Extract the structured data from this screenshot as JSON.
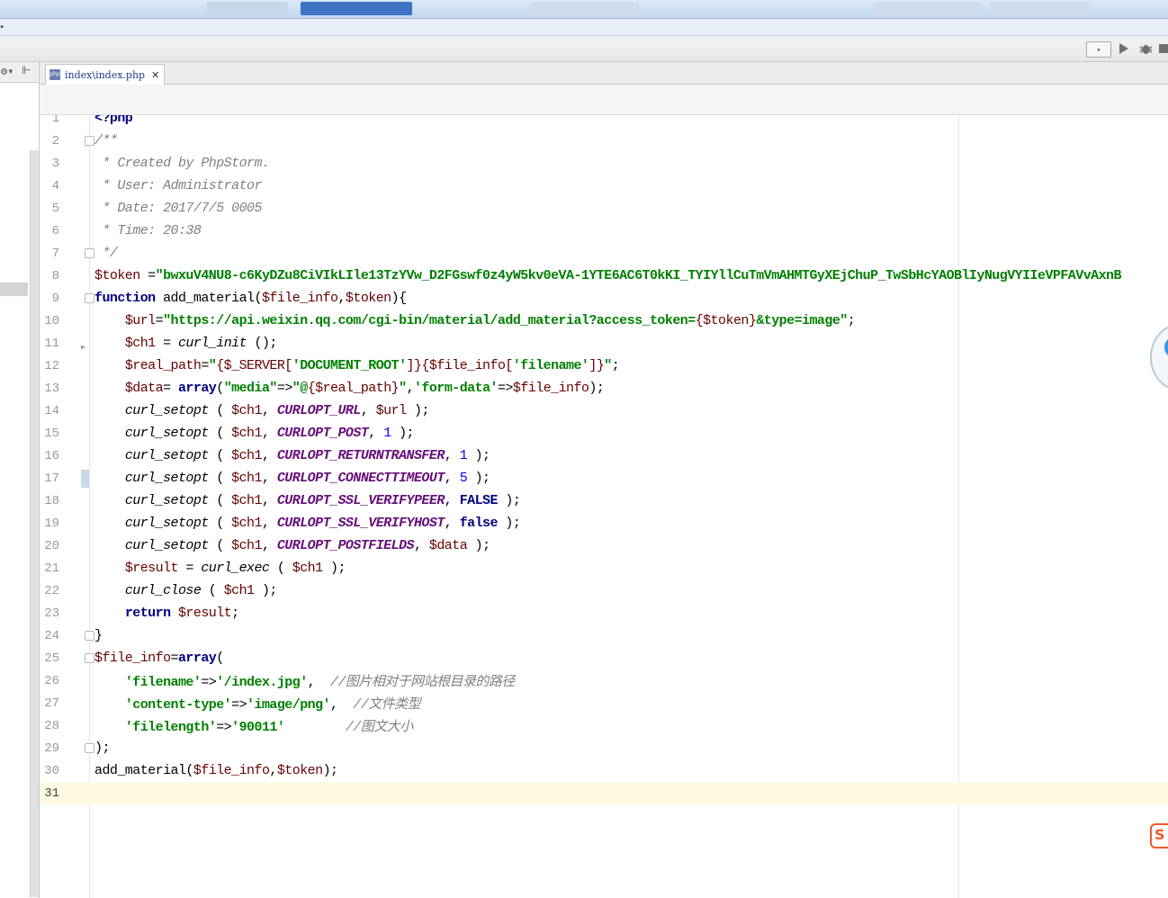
{
  "tab": {
    "label": "index\\index.php",
    "file_type": "php",
    "close": "✕"
  },
  "menu": {
    "caret": "▸"
  },
  "toolbar": {
    "run_config": "▾",
    "run": "▶",
    "debug": "✹"
  },
  "left_panel": {
    "gear": "⚙▾",
    "pin": "⊩"
  },
  "badge": {
    "logo_text": "S"
  },
  "editor": {
    "current_line": 31,
    "lines": [
      [
        {
          "t": "<?php",
          "c": "phptag"
        }
      ],
      [
        {
          "t": "/**",
          "c": "cmt"
        }
      ],
      [
        {
          "t": " * Created by PhpStorm.",
          "c": "cmt"
        }
      ],
      [
        {
          "t": " * User: Administrator",
          "c": "cmt"
        }
      ],
      [
        {
          "t": " * Date: 2017/7/5 0005",
          "c": "cmt"
        }
      ],
      [
        {
          "t": " * Time: 20:38",
          "c": "cmt"
        }
      ],
      [
        {
          "t": " */",
          "c": "cmt"
        }
      ],
      [
        {
          "t": "$token",
          "c": "var"
        },
        {
          "t": " =",
          "c": ""
        },
        {
          "t": "\"bwxuV4NU8-c6KyDZu8CiVIkLIle13TzYVw_D2FGswf0z4yW5kv0eVA-1YTE6AC6T0kKI_TYIYllCuTmVmAHMTGyXEjChuP_TwSbHcYAOBlIyNugVYIIeVPFAVvAxnB",
          "c": "str"
        }
      ],
      [
        {
          "t": "function",
          "c": "kw"
        },
        {
          "t": " add_material(",
          "c": ""
        },
        {
          "t": "$file_info",
          "c": "var"
        },
        {
          "t": ",",
          "c": ""
        },
        {
          "t": "$token",
          "c": "var"
        },
        {
          "t": "){",
          "c": ""
        }
      ],
      [
        {
          "t": "    ",
          "c": ""
        },
        {
          "t": "$url",
          "c": "var"
        },
        {
          "t": "=",
          "c": ""
        },
        {
          "t": "\"https://api.weixin.qq.com/cgi-bin/material/add_material?access_token=",
          "c": "str"
        },
        {
          "t": "{$token}",
          "c": "var"
        },
        {
          "t": "&type=image\"",
          "c": "str"
        },
        {
          "t": ";",
          "c": ""
        }
      ],
      [
        {
          "t": "    ",
          "c": ""
        },
        {
          "t": "$ch1",
          "c": "var"
        },
        {
          "t": " = ",
          "c": ""
        },
        {
          "t": "curl_init",
          "c": "fn"
        },
        {
          "t": " ();",
          "c": ""
        }
      ],
      [
        {
          "t": "    ",
          "c": ""
        },
        {
          "t": "$real_path",
          "c": "var"
        },
        {
          "t": "=",
          "c": ""
        },
        {
          "t": "\"",
          "c": "str"
        },
        {
          "t": "{$_SERVER[",
          "c": "var"
        },
        {
          "t": "'DOCUMENT_ROOT'",
          "c": "str"
        },
        {
          "t": "]}{$file_info[",
          "c": "var"
        },
        {
          "t": "'filename'",
          "c": "str"
        },
        {
          "t": "]}",
          "c": "var"
        },
        {
          "t": "\"",
          "c": "str"
        },
        {
          "t": ";",
          "c": ""
        }
      ],
      [
        {
          "t": "    ",
          "c": ""
        },
        {
          "t": "$data",
          "c": "var"
        },
        {
          "t": "= ",
          "c": ""
        },
        {
          "t": "array",
          "c": "kw"
        },
        {
          "t": "(",
          "c": ""
        },
        {
          "t": "\"media\"",
          "c": "str"
        },
        {
          "t": "=>",
          "c": ""
        },
        {
          "t": "\"@",
          "c": "str"
        },
        {
          "t": "{$real_path}",
          "c": "var"
        },
        {
          "t": "\"",
          "c": "str"
        },
        {
          "t": ",",
          "c": ""
        },
        {
          "t": "'form-data'",
          "c": "str"
        },
        {
          "t": "=>",
          "c": ""
        },
        {
          "t": "$file_info",
          "c": "var"
        },
        {
          "t": ");",
          "c": ""
        }
      ],
      [
        {
          "t": "    ",
          "c": ""
        },
        {
          "t": "curl_setopt",
          "c": "fn"
        },
        {
          "t": " ( ",
          "c": ""
        },
        {
          "t": "$ch1",
          "c": "var"
        },
        {
          "t": ", ",
          "c": ""
        },
        {
          "t": "CURLOPT_URL",
          "c": "const"
        },
        {
          "t": ", ",
          "c": ""
        },
        {
          "t": "$url",
          "c": "var"
        },
        {
          "t": " );",
          "c": ""
        }
      ],
      [
        {
          "t": "    ",
          "c": ""
        },
        {
          "t": "curl_setopt",
          "c": "fn"
        },
        {
          "t": " ( ",
          "c": ""
        },
        {
          "t": "$ch1",
          "c": "var"
        },
        {
          "t": ", ",
          "c": ""
        },
        {
          "t": "CURLOPT_POST",
          "c": "const"
        },
        {
          "t": ", ",
          "c": ""
        },
        {
          "t": "1",
          "c": "num"
        },
        {
          "t": " );",
          "c": ""
        }
      ],
      [
        {
          "t": "    ",
          "c": ""
        },
        {
          "t": "curl_setopt",
          "c": "fn"
        },
        {
          "t": " ( ",
          "c": ""
        },
        {
          "t": "$ch1",
          "c": "var"
        },
        {
          "t": ", ",
          "c": ""
        },
        {
          "t": "CURLOPT_RETURNTRANSFER",
          "c": "const"
        },
        {
          "t": ", ",
          "c": ""
        },
        {
          "t": "1",
          "c": "num"
        },
        {
          "t": " );",
          "c": ""
        }
      ],
      [
        {
          "t": "    ",
          "c": ""
        },
        {
          "t": "curl_setopt",
          "c": "fn"
        },
        {
          "t": " ( ",
          "c": ""
        },
        {
          "t": "$ch1",
          "c": "var"
        },
        {
          "t": ", ",
          "c": ""
        },
        {
          "t": "CURLOPT_CONNECTTIMEOUT",
          "c": "const"
        },
        {
          "t": ", ",
          "c": ""
        },
        {
          "t": "5",
          "c": "num"
        },
        {
          "t": " );",
          "c": ""
        }
      ],
      [
        {
          "t": "    ",
          "c": ""
        },
        {
          "t": "curl_setopt",
          "c": "fn"
        },
        {
          "t": " ( ",
          "c": ""
        },
        {
          "t": "$ch1",
          "c": "var"
        },
        {
          "t": ", ",
          "c": ""
        },
        {
          "t": "CURLOPT_SSL_VERIFYPEER",
          "c": "const"
        },
        {
          "t": ", ",
          "c": ""
        },
        {
          "t": "FALSE",
          "c": "kw"
        },
        {
          "t": " );",
          "c": ""
        }
      ],
      [
        {
          "t": "    ",
          "c": ""
        },
        {
          "t": "curl_setopt",
          "c": "fn"
        },
        {
          "t": " ( ",
          "c": ""
        },
        {
          "t": "$ch1",
          "c": "var"
        },
        {
          "t": ", ",
          "c": ""
        },
        {
          "t": "CURLOPT_SSL_VERIFYHOST",
          "c": "const"
        },
        {
          "t": ", ",
          "c": ""
        },
        {
          "t": "false",
          "c": "kw"
        },
        {
          "t": " );",
          "c": ""
        }
      ],
      [
        {
          "t": "    ",
          "c": ""
        },
        {
          "t": "curl_setopt",
          "c": "fn"
        },
        {
          "t": " ( ",
          "c": ""
        },
        {
          "t": "$ch1",
          "c": "var"
        },
        {
          "t": ", ",
          "c": ""
        },
        {
          "t": "CURLOPT_POSTFIELDS",
          "c": "const"
        },
        {
          "t": ", ",
          "c": ""
        },
        {
          "t": "$data",
          "c": "var"
        },
        {
          "t": " );",
          "c": ""
        }
      ],
      [
        {
          "t": "    ",
          "c": ""
        },
        {
          "t": "$result",
          "c": "var"
        },
        {
          "t": " = ",
          "c": ""
        },
        {
          "t": "curl_exec",
          "c": "fn"
        },
        {
          "t": " ( ",
          "c": ""
        },
        {
          "t": "$ch1",
          "c": "var"
        },
        {
          "t": " );",
          "c": ""
        }
      ],
      [
        {
          "t": "    ",
          "c": ""
        },
        {
          "t": "curl_close",
          "c": "fn"
        },
        {
          "t": " ( ",
          "c": ""
        },
        {
          "t": "$ch1",
          "c": "var"
        },
        {
          "t": " );",
          "c": ""
        }
      ],
      [
        {
          "t": "    ",
          "c": ""
        },
        {
          "t": "return",
          "c": "kw"
        },
        {
          "t": " ",
          "c": ""
        },
        {
          "t": "$result",
          "c": "var"
        },
        {
          "t": ";",
          "c": ""
        }
      ],
      [
        {
          "t": "}",
          "c": ""
        }
      ],
      [
        {
          "t": "$file_info",
          "c": "var"
        },
        {
          "t": "=",
          "c": ""
        },
        {
          "t": "array",
          "c": "kw"
        },
        {
          "t": "(",
          "c": ""
        }
      ],
      [
        {
          "t": "    ",
          "c": ""
        },
        {
          "t": "'filename'",
          "c": "str"
        },
        {
          "t": "=>",
          "c": ""
        },
        {
          "t": "'/index.jpg'",
          "c": "str"
        },
        {
          "t": ",  ",
          "c": ""
        },
        {
          "t": "//图片相对于网站根目录的路径",
          "c": "cmt"
        }
      ],
      [
        {
          "t": "    ",
          "c": ""
        },
        {
          "t": "'content-type'",
          "c": "str"
        },
        {
          "t": "=>",
          "c": ""
        },
        {
          "t": "'image/png'",
          "c": "str"
        },
        {
          "t": ",  ",
          "c": ""
        },
        {
          "t": "//文件类型",
          "c": "cmt"
        }
      ],
      [
        {
          "t": "    ",
          "c": ""
        },
        {
          "t": "'filelength'",
          "c": "str"
        },
        {
          "t": "=>",
          "c": ""
        },
        {
          "t": "'90011'",
          "c": "str"
        },
        {
          "t": "        ",
          "c": ""
        },
        {
          "t": "//图文大小",
          "c": "cmt"
        }
      ],
      [
        {
          "t": ");",
          "c": ""
        }
      ],
      [
        {
          "t": "add_material(",
          "c": ""
        },
        {
          "t": "$file_info",
          "c": "var"
        },
        {
          "t": ",",
          "c": ""
        },
        {
          "t": "$token",
          "c": "var"
        },
        {
          "t": ");",
          "c": ""
        }
      ],
      [
        {
          "t": "",
          "c": ""
        }
      ]
    ]
  }
}
